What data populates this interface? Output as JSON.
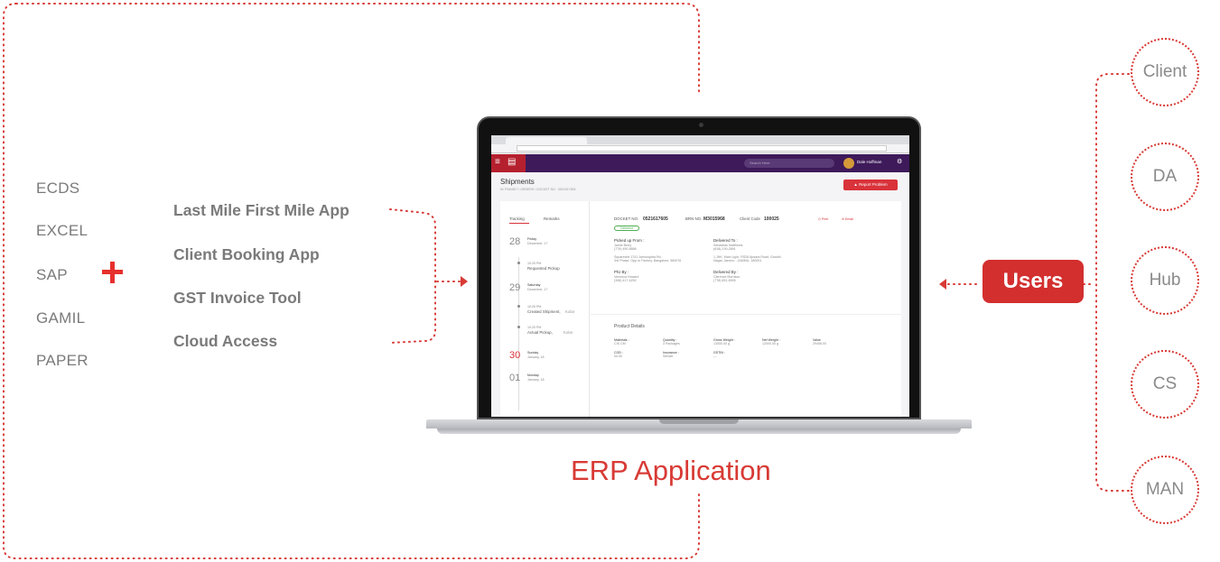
{
  "sources": [
    "ECDS",
    "EXCEL",
    "SAP",
    "GAMIL",
    "PAPER"
  ],
  "apps": [
    "Last Mile First Mile App",
    "Client Booking App",
    "GST Invoice Tool",
    "Cloud Access"
  ],
  "center_label": "ERP Application",
  "users_label": "Users",
  "user_roles": [
    "Client",
    "DA",
    "Hub",
    "CS",
    "MAN"
  ],
  "colors": {
    "accent": "#d83a35",
    "text_gray": "#7a7a7a",
    "nav_purple": "#3e1a5a"
  },
  "screen": {
    "search_placeholder": "Search Here",
    "user_name": "Dale Hoffman",
    "title": "Shipments",
    "breadcrumb": "IN TRANSIT  /  ORDERS  /  DOCKET NO - 0521617605",
    "report_button": "Report Problem",
    "tabs": [
      "Tracking",
      "Remarks"
    ],
    "docket_label": "DOCKET NO.",
    "docket_no": "0521617605",
    "brn_label": "BRN NO.",
    "brn_no": "M3015968",
    "client_label": "Client Code",
    "client_code": "100025",
    "print": "Print",
    "email": "Email",
    "status": "Delivered",
    "picked_up_label": "Picked up From :",
    "picked_up_name": "Jamie Berry",
    "picked_up_phone": "(779) 490-8886",
    "picked_up_addr": "Squarechit 1741 Jamunqutta Rd,",
    "picked_up_addr2": "3rd Phase, Opp to Factory, Bangalore, 560076",
    "delivered_to_label": "Delivered To :",
    "delivered_to_name": "Sebastian Matthews",
    "delivered_to_phone": "(618)-190-2891",
    "delivered_to_addr": "1,JHK, Main Lyph, RS26 Apsara Road, Gandhi",
    "delivered_to_addr2": "Nagar, Jammu - JAMMU, 180001",
    "pub_label": "P/U By :",
    "pub_name": "Veronica Howard",
    "pub_phone": "(398) 417-6252",
    "delby_label": "Delivered By :",
    "delby_name": "Clarence Morrison",
    "delby_phone": "(778) 651-8905",
    "timeline": [
      {
        "day": "28",
        "weekday": "Friday",
        "month": "December, 17"
      },
      {
        "time": "10:25 PM",
        "event": "Requested Pickup"
      },
      {
        "day": "29",
        "weekday": "Saturday",
        "month": "December, 17"
      },
      {
        "time": "10:25 PM",
        "event": "Created Shipment,",
        "place": "Kolar"
      },
      {
        "time": "10:25 PM",
        "event": "Actual Pickup,",
        "place": "Kolar"
      },
      {
        "day": "30",
        "weekday": "Sunday",
        "month": "January, 18"
      },
      {
        "day": "01",
        "weekday": "Monday",
        "month": "January, 18"
      }
    ],
    "product_title": "Product Details",
    "product": {
      "materials_label": "Materials :",
      "materials": "CIS CM",
      "quantity_label": "Quantity :",
      "quantity": "3 Packages",
      "gross_label": "Gross Weight :",
      "gross": "13000.00 g",
      "net_label": "Net Weight :",
      "net": "12000.00 g",
      "value_label": "Value",
      "value": "29456.00",
      "cod_label": "COD :",
      "cod": "00.00",
      "insurance_label": "Insurance :",
      "insurance": "Sender",
      "gstin_label": "GSTIN :",
      "gstin": "---"
    }
  }
}
